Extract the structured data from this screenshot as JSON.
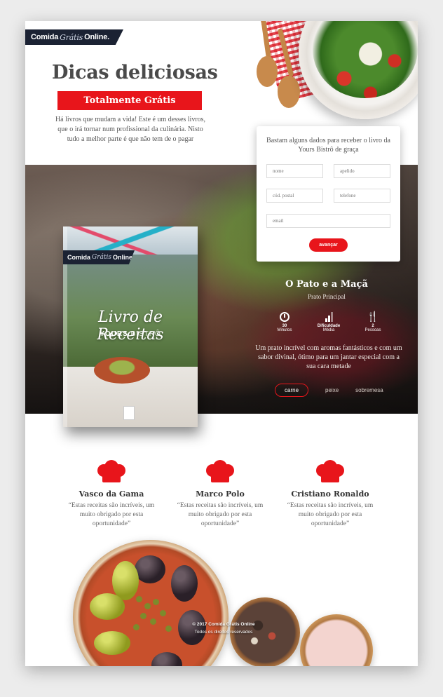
{
  "brand": {
    "logo_prefix": "Comida",
    "logo_mid": "Grátis",
    "logo_suffix": "Online."
  },
  "hero": {
    "title": "Dicas deliciosas",
    "badge": "Totalmente Grátis",
    "text": "Há livros que mudam a vida! Este é um desses livros, que o irá tornar num profissional da culinária. Nisto tudo a melhor parte é que não tem de o pagar"
  },
  "form": {
    "title": "Bastam alguns dados para receber o livro da Yours Bistrô de graça",
    "fields": {
      "nome": "nome",
      "apelido": "apelido",
      "cod_postal": "cód. postal",
      "telefone": "telefone",
      "email": "email"
    },
    "submit": "avançar"
  },
  "book": {
    "logo_prefix": "Comida",
    "logo_mid": "Grátis",
    "logo_suffix": "Online.",
    "title": "Livro de Receitas",
    "sub_bold": "YOURS",
    "sub_light": "BISTRÔ"
  },
  "recipe": {
    "title": "O Pato e a Maçã",
    "subtitle": "Prato Principal",
    "stats": [
      {
        "icon": "clock-icon",
        "value": "30",
        "label": "Minutos"
      },
      {
        "icon": "difficulty-icon",
        "value": "Dificuldade",
        "label": "Média"
      },
      {
        "icon": "cutlery-icon",
        "value": "2",
        "label": "Pessoas"
      }
    ],
    "description": "Um prato incrível com aromas fantásticos e com um sabor divinal, ótimo para um jantar especial com a sua cara metade",
    "tabs": [
      "carne",
      "peixe",
      "sobremesa"
    ],
    "active_tab": "carne"
  },
  "testimonials": [
    {
      "name": "Vasco da Gama",
      "text": "“Estas receitas são incríveis, um muito obrigado por esta oportunidade”"
    },
    {
      "name": "Marco Polo",
      "text": "“Estas receitas são incríveis, um muito obrigado por esta oportunidade”"
    },
    {
      "name": "Cristiano Ronaldo",
      "text": "“Estas receitas são incríveis, um muito obrigado por esta oportunidade”"
    }
  ],
  "footer": {
    "copyright": "© 2017 Comida Grátis Online",
    "rights": "Todos os direitos reservados"
  },
  "colors": {
    "accent": "#e8151b",
    "navy": "#1b2233",
    "text": "#4a4a4a"
  }
}
